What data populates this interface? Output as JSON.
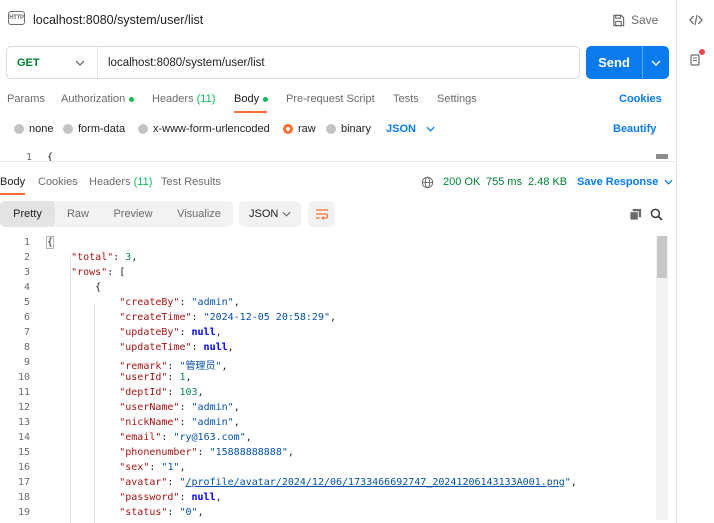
{
  "titlebar": {
    "badge": "HTTP",
    "title": "localhost:8080/system/user/list",
    "save_label": "Save"
  },
  "request": {
    "method": "GET",
    "url": "localhost:8080/system/user/list",
    "send_label": "Send"
  },
  "request_tabs": [
    {
      "label": "Params"
    },
    {
      "label": "Authorization"
    },
    {
      "label": "Headers",
      "count": "(11)"
    },
    {
      "label": "Body"
    },
    {
      "label": "Pre-request Script"
    },
    {
      "label": "Tests"
    },
    {
      "label": "Settings"
    }
  ],
  "cookies_label": "Cookies",
  "body_options": {
    "types": [
      "none",
      "form-data",
      "x-www-form-urlencoded",
      "raw",
      "binary"
    ],
    "selected": "raw",
    "format": "JSON",
    "beautify_label": "Beautify"
  },
  "request_editor": {
    "line": "1",
    "text": "{"
  },
  "response_tabs": [
    {
      "label": "Body"
    },
    {
      "label": "Cookies"
    },
    {
      "label": "Headers",
      "count": "(11)"
    },
    {
      "label": "Test Results"
    }
  ],
  "response_status": {
    "status": "200 OK",
    "time": "755 ms",
    "size": "2.48 KB",
    "save_response_label": "Save Response"
  },
  "view_modes": [
    "Pretty",
    "Raw",
    "Preview",
    "Visualize"
  ],
  "view_format": "JSON",
  "response_body": {
    "line_numbers": [
      "1",
      "2",
      "3",
      "4",
      "5",
      "6",
      "7",
      "8",
      "9",
      "10",
      "11",
      "12",
      "13",
      "14",
      "15",
      "16",
      "17",
      "18",
      "19"
    ],
    "total": "3",
    "createBy": "admin",
    "createTime": "2024-12-05 20:58:29",
    "updateBy": "null",
    "updateTime": "null",
    "remark": "管理员",
    "userId": "1",
    "deptId": "103",
    "userName": "admin",
    "nickName": "admin",
    "email": "ry@163.com",
    "phonenumber": "15888888888",
    "sex": "1",
    "avatar": "/profile/avatar/2024/12/06/1733466692747_20241206143133A001.png",
    "password": "null",
    "status": "0"
  },
  "colors": {
    "accent_orange": "#ff6c37",
    "send_blue": "#097bed",
    "success_green": "#007f31",
    "dot_green": "#0cbb52"
  }
}
